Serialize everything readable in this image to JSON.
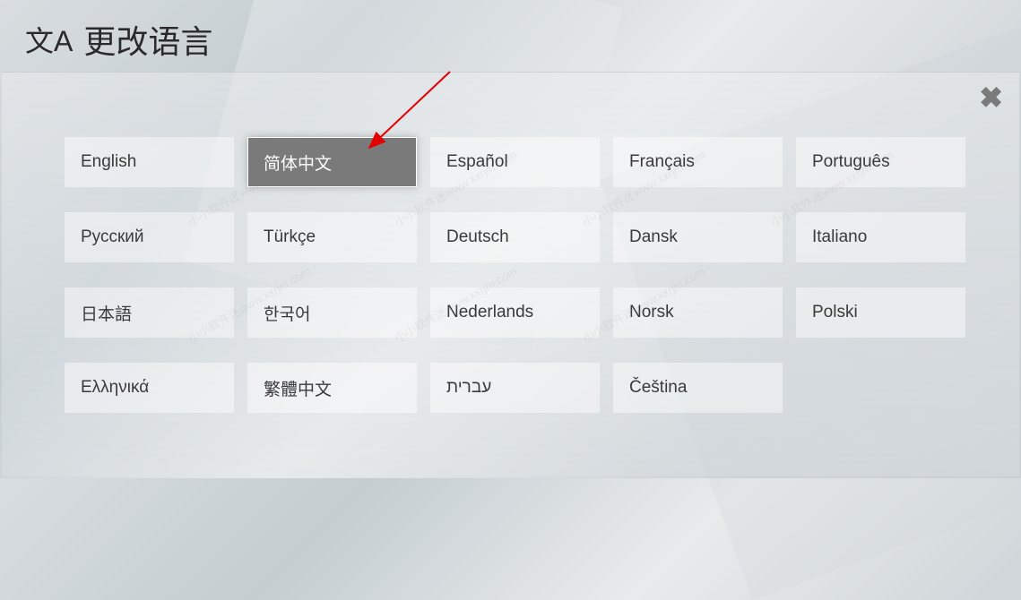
{
  "header": {
    "icon_glyph": "文A",
    "title": "更改语言"
  },
  "close": {
    "glyph": "✖"
  },
  "languages": [
    {
      "label": "English",
      "selected": false
    },
    {
      "label": "简体中文",
      "selected": true
    },
    {
      "label": "Español",
      "selected": false
    },
    {
      "label": "Français",
      "selected": false
    },
    {
      "label": "Português",
      "selected": false
    },
    {
      "label": "Русский",
      "selected": false
    },
    {
      "label": "Türkçe",
      "selected": false
    },
    {
      "label": "Deutsch",
      "selected": false
    },
    {
      "label": "Dansk",
      "selected": false
    },
    {
      "label": "Italiano",
      "selected": false
    },
    {
      "label": "日本語",
      "selected": false
    },
    {
      "label": "한국어",
      "selected": false
    },
    {
      "label": "Nederlands",
      "selected": false
    },
    {
      "label": "Norsk",
      "selected": false
    },
    {
      "label": "Polski",
      "selected": false
    },
    {
      "label": "Ελληνικά",
      "selected": false
    },
    {
      "label": "繁體中文",
      "selected": false
    },
    {
      "label": "עברית",
      "selected": false
    },
    {
      "label": "Čeština",
      "selected": false
    }
  ],
  "watermark_text": "小小软件迷www.xxrjm.com",
  "arrow_color": "#e20000"
}
